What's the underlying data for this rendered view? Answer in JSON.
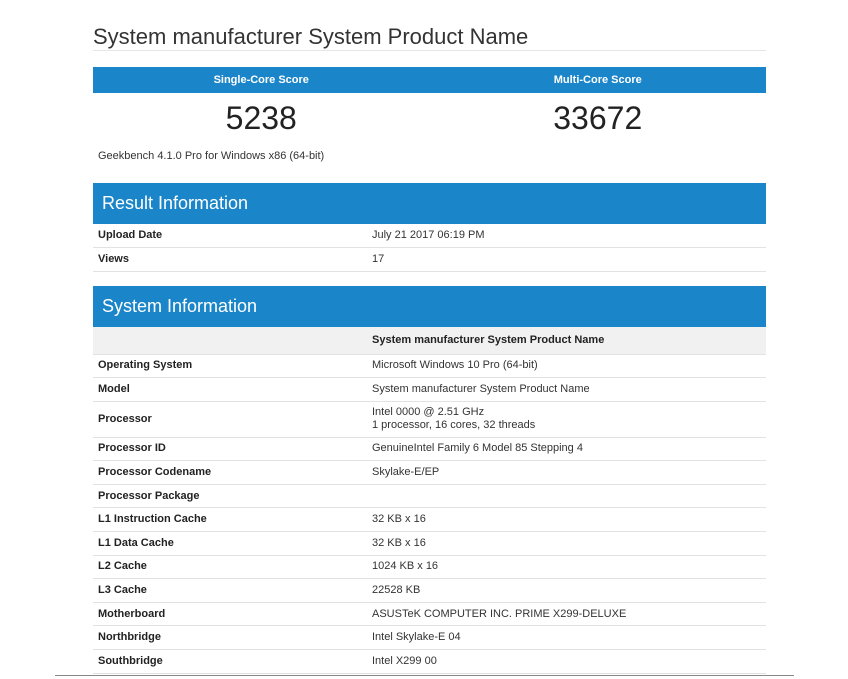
{
  "header": {
    "title": "System manufacturer System Product Name"
  },
  "scores": {
    "single_label": "Single-Core Score",
    "multi_label": "Multi-Core Score",
    "single_value": "5238",
    "multi_value": "33672",
    "version": "Geekbench 4.1.0 Pro for Windows x86 (64-bit)"
  },
  "result": {
    "heading": "Result Information",
    "rows": [
      {
        "label": "Upload Date",
        "value": "July 21 2017 06:19 PM"
      },
      {
        "label": "Views",
        "value": "17"
      }
    ]
  },
  "system": {
    "heading": "System Information",
    "column_header": "System manufacturer System Product Name",
    "rows": [
      {
        "label": "Operating System",
        "value": "Microsoft Windows 10 Pro (64-bit)"
      },
      {
        "label": "Model",
        "value": "System manufacturer System Product Name"
      },
      {
        "label": "Processor",
        "value": "Intel 0000 @ 2.51 GHz",
        "value2": "1 processor, 16 cores, 32 threads"
      },
      {
        "label": "Processor ID",
        "value": "GenuineIntel Family 6 Model 85 Stepping 4"
      },
      {
        "label": "Processor Codename",
        "value": "Skylake-E/EP"
      },
      {
        "label": "Processor Package",
        "value": ""
      },
      {
        "label": "L1 Instruction Cache",
        "value": "32 KB x 16"
      },
      {
        "label": "L1 Data Cache",
        "value": "32 KB x 16"
      },
      {
        "label": "L2 Cache",
        "value": "1024 KB x 16"
      },
      {
        "label": "L3 Cache",
        "value": "22528 KB"
      },
      {
        "label": "Motherboard",
        "value": "ASUSTeK COMPUTER INC. PRIME X299-DELUXE"
      },
      {
        "label": "Northbridge",
        "value": "Intel Skylake-E 04"
      },
      {
        "label": "Southbridge",
        "value": "Intel X299 00"
      }
    ]
  },
  "colors": {
    "accent": "#1a85c8",
    "row_header_bg": "#f1f1f1",
    "divider": "#e2e2e2"
  }
}
